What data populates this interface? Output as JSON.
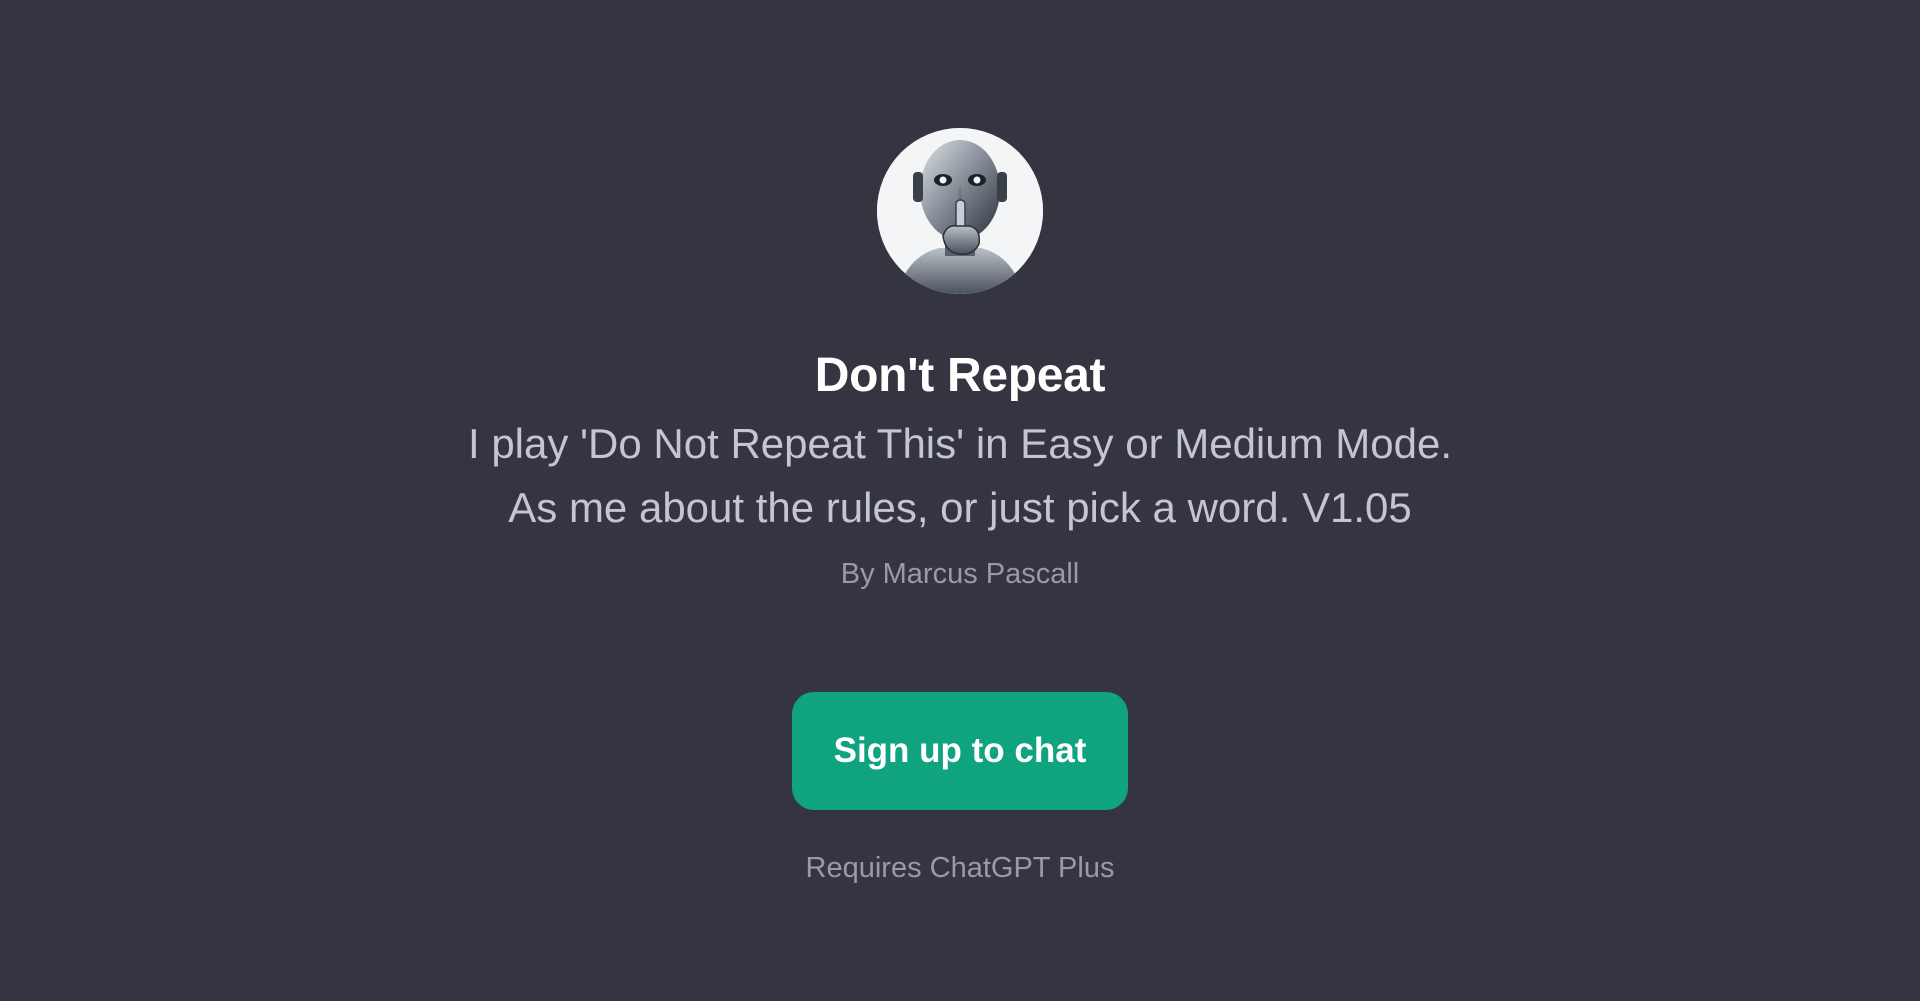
{
  "gpt": {
    "avatar_icon": "robot-shush-avatar",
    "title": "Don't Repeat",
    "description": "I play 'Do Not Repeat This' in Easy or Medium Mode. As me about the rules, or just pick a word. V1.05",
    "author": "By Marcus Pascall"
  },
  "actions": {
    "signup_label": "Sign up to chat",
    "requirement": "Requires ChatGPT Plus"
  },
  "colors": {
    "background": "#343541",
    "accent": "#10a37f",
    "title": "#ffffff",
    "description": "#c5c5d2",
    "muted": "#9a9aa6"
  }
}
